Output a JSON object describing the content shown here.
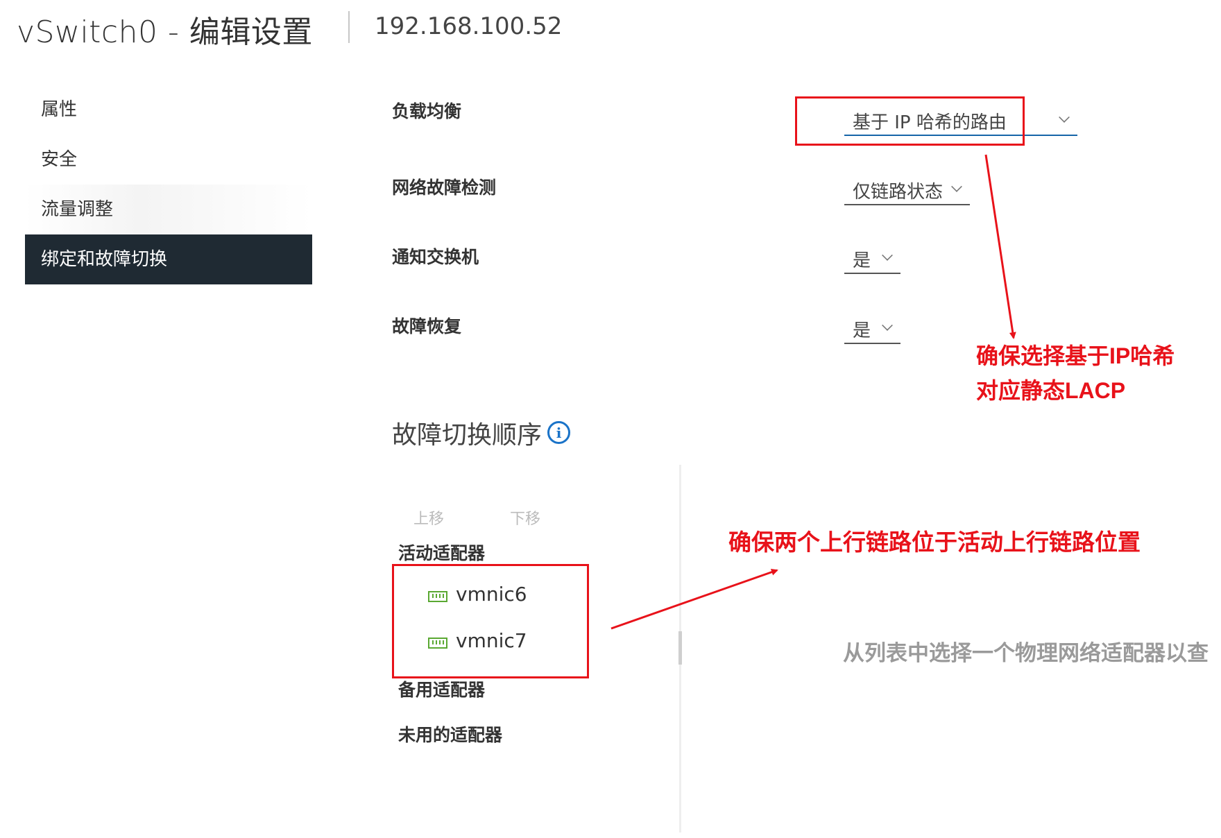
{
  "header": {
    "title": "vSwitch0 - 编辑设置",
    "host": "192.168.100.52"
  },
  "sidebar": {
    "items": [
      {
        "label": "属性",
        "active": false
      },
      {
        "label": "安全",
        "active": false
      },
      {
        "label": "流量调整",
        "active": false
      },
      {
        "label": "绑定和故障切换",
        "active": true
      }
    ]
  },
  "settings": {
    "load_balancing": {
      "label": "负载均衡",
      "value": "基于 IP 哈希的路由"
    },
    "failure_detection": {
      "label": "网络故障检测",
      "value": "仅链路状态"
    },
    "notify_switches": {
      "label": "通知交换机",
      "value": "是"
    },
    "failback": {
      "label": "故障恢复",
      "value": "是"
    }
  },
  "failover": {
    "title": "故障切换顺序",
    "move_up": "上移",
    "move_down": "下移",
    "active_label": "活动适配器",
    "active_adapters": [
      "vmnic6",
      "vmnic7"
    ],
    "standby_label": "备用适配器",
    "unused_label": "未用的适配器",
    "empty_text": "从列表中选择一个物理网络适配器以查"
  },
  "annotations": {
    "lb_note_line1": "确保选择基于IP哈希",
    "lb_note_line2": "对应静态LACP",
    "uplink_note": "确保两个上行链路位于活动上行链路位置"
  },
  "colors": {
    "sidebar_active_bg": "#1f2a33",
    "annotation_red": "#e8121a",
    "info_blue": "#1a73c8",
    "nic_green": "#5aa832"
  },
  "icons": {
    "info": "info-circle-icon",
    "chevron": "chevron-down-icon",
    "nic": "network-adapter-icon"
  }
}
